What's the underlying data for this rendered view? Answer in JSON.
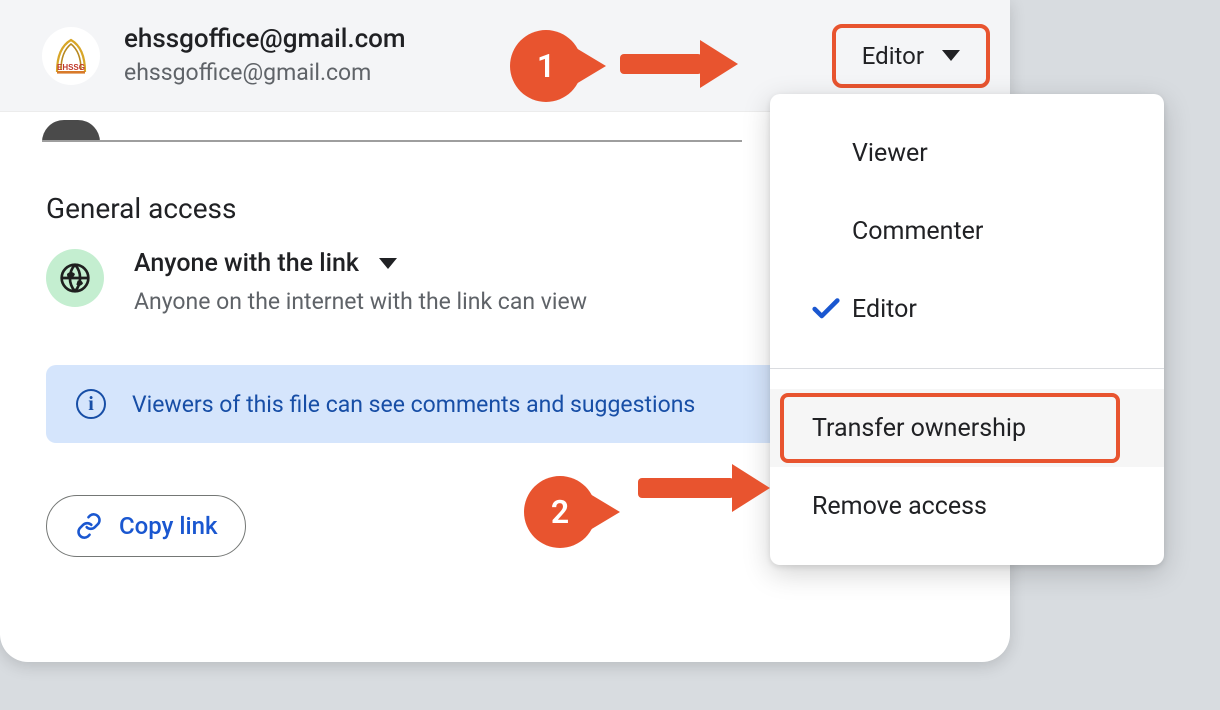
{
  "user": {
    "name": "ehssgoffice@gmail.com",
    "email": "ehssgoffice@gmail.com",
    "role_label": "Editor",
    "avatar_text": "EHSSG"
  },
  "section": {
    "general_access_title": "General access"
  },
  "general_access": {
    "label": "Anyone with the link",
    "description": "Anyone on the internet with the link can view"
  },
  "info": {
    "text": "Viewers of this file can see comments and suggestions"
  },
  "copy_link": {
    "label": "Copy link"
  },
  "menu": {
    "viewer": "Viewer",
    "commenter": "Commenter",
    "editor": "Editor",
    "transfer": "Transfer ownership",
    "remove": "Remove access",
    "selected": "editor"
  },
  "callouts": {
    "one": "1",
    "two": "2"
  }
}
